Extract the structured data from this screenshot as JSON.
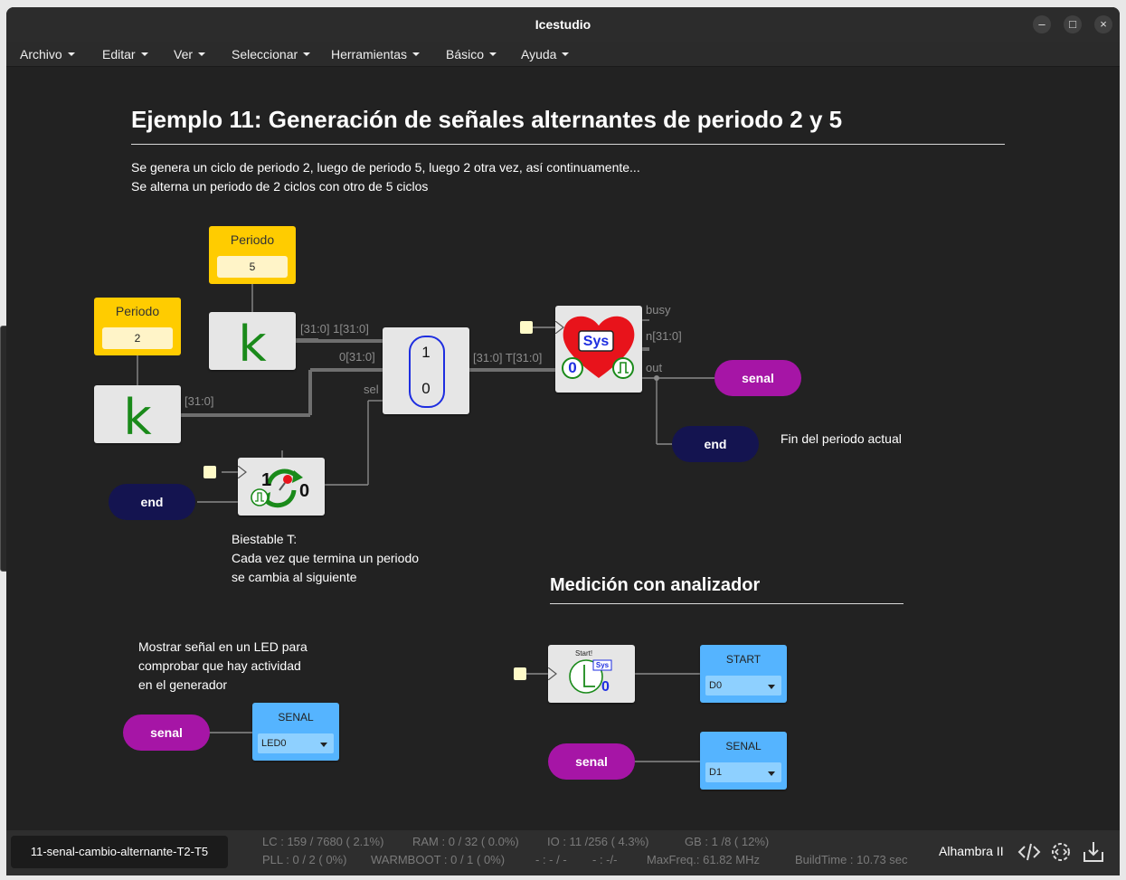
{
  "window": {
    "title": "Icestudio"
  },
  "menu": [
    "Archivo",
    "Editar",
    "Ver",
    "Seleccionar",
    "Herramientas",
    "Básico",
    "Ayuda"
  ],
  "canvas": {
    "title": "Ejemplo 11: Generación de señales alternantes de periodo 2 y 5",
    "desc_line1": "Se genera un ciclo de periodo 2, luego de periodo 5, luego 2 otra vez, así continuamente...",
    "desc_line2": "Se alterna un periodo de 2 ciclos con otro de 5 ciclos",
    "const1": {
      "label": "Periodo",
      "value": "2"
    },
    "const2": {
      "label": "Periodo",
      "value": "5"
    },
    "k_glyph": "k",
    "mux": {
      "in1": "1",
      "in0": "0",
      "label_in1": "[31:0]  1[31:0]",
      "label_in0": "0[31:0]",
      "label_sel": "sel",
      "label_out": "[31:0]  T[31:0]",
      "label_k1": "[31:0]"
    },
    "timer": {
      "label": "Sys",
      "zero": "0",
      "port_busy": "busy",
      "port_n": "n[31:0]",
      "port_out": "out"
    },
    "toggle": {
      "one": "1",
      "zero": "0"
    },
    "pill_senal": "senal",
    "pill_end": "end",
    "fin_note": "Fin del periodo actual",
    "biestable_note": [
      "Biestable T:",
      "Cada vez que termina un periodo",
      "se cambia al siguiente"
    ],
    "led_note": [
      "Mostrar señal en un LED para",
      "comprobar que hay actividad",
      "en el generador"
    ],
    "led_out": {
      "label": "SENAL",
      "pin": "LED0"
    },
    "analyzer": {
      "title": "Medición con analizador",
      "start_block": {
        "label": "Start!",
        "sys": "Sys",
        "zero": "0"
      },
      "start_out": {
        "label": "START",
        "pin": "D0"
      },
      "senal_out": {
        "label": "SENAL",
        "pin": "D1"
      }
    }
  },
  "status": {
    "filename": "11-senal-cambio-alternante-T2-T5",
    "lc": "LC : 159 / 7680 ( 2.1%)",
    "ram": "RAM : 0 / 32 ( 0.0%)",
    "io": "IO :  11 /256  ( 4.3%)",
    "gb": "GB :  1 /8  ( 12%)",
    "pll": "PLL : 0 / 2 ( 0%)",
    "warmboot": "WARMBOOT : 0 / 1 ( 0%)",
    "misc1": "- : - / -",
    "misc2": "- :  -/-",
    "maxfreq": "MaxFreq.:  61.82 MHz",
    "buildtime": "BuildTime :  10.73 sec",
    "board": "Alhambra II"
  }
}
